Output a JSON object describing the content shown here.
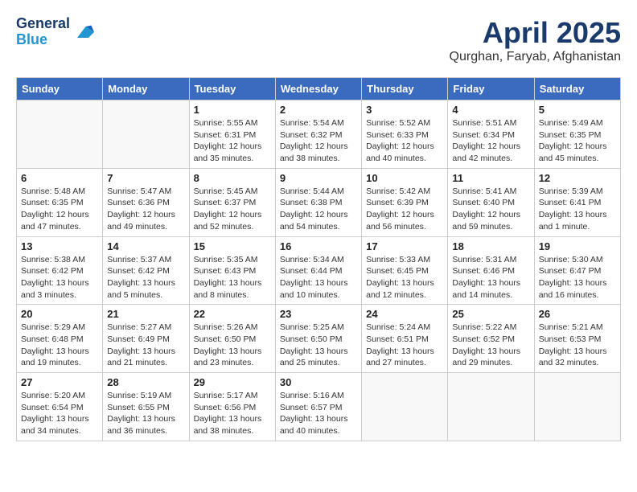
{
  "header": {
    "logo_line1": "General",
    "logo_line2": "Blue",
    "month_title": "April 2025",
    "location": "Qurghan, Faryab, Afghanistan"
  },
  "weekdays": [
    "Sunday",
    "Monday",
    "Tuesday",
    "Wednesday",
    "Thursday",
    "Friday",
    "Saturday"
  ],
  "weeks": [
    [
      {
        "day": "",
        "info": ""
      },
      {
        "day": "",
        "info": ""
      },
      {
        "day": "1",
        "info": "Sunrise: 5:55 AM\nSunset: 6:31 PM\nDaylight: 12 hours and 35 minutes."
      },
      {
        "day": "2",
        "info": "Sunrise: 5:54 AM\nSunset: 6:32 PM\nDaylight: 12 hours and 38 minutes."
      },
      {
        "day": "3",
        "info": "Sunrise: 5:52 AM\nSunset: 6:33 PM\nDaylight: 12 hours and 40 minutes."
      },
      {
        "day": "4",
        "info": "Sunrise: 5:51 AM\nSunset: 6:34 PM\nDaylight: 12 hours and 42 minutes."
      },
      {
        "day": "5",
        "info": "Sunrise: 5:49 AM\nSunset: 6:35 PM\nDaylight: 12 hours and 45 minutes."
      }
    ],
    [
      {
        "day": "6",
        "info": "Sunrise: 5:48 AM\nSunset: 6:35 PM\nDaylight: 12 hours and 47 minutes."
      },
      {
        "day": "7",
        "info": "Sunrise: 5:47 AM\nSunset: 6:36 PM\nDaylight: 12 hours and 49 minutes."
      },
      {
        "day": "8",
        "info": "Sunrise: 5:45 AM\nSunset: 6:37 PM\nDaylight: 12 hours and 52 minutes."
      },
      {
        "day": "9",
        "info": "Sunrise: 5:44 AM\nSunset: 6:38 PM\nDaylight: 12 hours and 54 minutes."
      },
      {
        "day": "10",
        "info": "Sunrise: 5:42 AM\nSunset: 6:39 PM\nDaylight: 12 hours and 56 minutes."
      },
      {
        "day": "11",
        "info": "Sunrise: 5:41 AM\nSunset: 6:40 PM\nDaylight: 12 hours and 59 minutes."
      },
      {
        "day": "12",
        "info": "Sunrise: 5:39 AM\nSunset: 6:41 PM\nDaylight: 13 hours and 1 minute."
      }
    ],
    [
      {
        "day": "13",
        "info": "Sunrise: 5:38 AM\nSunset: 6:42 PM\nDaylight: 13 hours and 3 minutes."
      },
      {
        "day": "14",
        "info": "Sunrise: 5:37 AM\nSunset: 6:42 PM\nDaylight: 13 hours and 5 minutes."
      },
      {
        "day": "15",
        "info": "Sunrise: 5:35 AM\nSunset: 6:43 PM\nDaylight: 13 hours and 8 minutes."
      },
      {
        "day": "16",
        "info": "Sunrise: 5:34 AM\nSunset: 6:44 PM\nDaylight: 13 hours and 10 minutes."
      },
      {
        "day": "17",
        "info": "Sunrise: 5:33 AM\nSunset: 6:45 PM\nDaylight: 13 hours and 12 minutes."
      },
      {
        "day": "18",
        "info": "Sunrise: 5:31 AM\nSunset: 6:46 PM\nDaylight: 13 hours and 14 minutes."
      },
      {
        "day": "19",
        "info": "Sunrise: 5:30 AM\nSunset: 6:47 PM\nDaylight: 13 hours and 16 minutes."
      }
    ],
    [
      {
        "day": "20",
        "info": "Sunrise: 5:29 AM\nSunset: 6:48 PM\nDaylight: 13 hours and 19 minutes."
      },
      {
        "day": "21",
        "info": "Sunrise: 5:27 AM\nSunset: 6:49 PM\nDaylight: 13 hours and 21 minutes."
      },
      {
        "day": "22",
        "info": "Sunrise: 5:26 AM\nSunset: 6:50 PM\nDaylight: 13 hours and 23 minutes."
      },
      {
        "day": "23",
        "info": "Sunrise: 5:25 AM\nSunset: 6:50 PM\nDaylight: 13 hours and 25 minutes."
      },
      {
        "day": "24",
        "info": "Sunrise: 5:24 AM\nSunset: 6:51 PM\nDaylight: 13 hours and 27 minutes."
      },
      {
        "day": "25",
        "info": "Sunrise: 5:22 AM\nSunset: 6:52 PM\nDaylight: 13 hours and 29 minutes."
      },
      {
        "day": "26",
        "info": "Sunrise: 5:21 AM\nSunset: 6:53 PM\nDaylight: 13 hours and 32 minutes."
      }
    ],
    [
      {
        "day": "27",
        "info": "Sunrise: 5:20 AM\nSunset: 6:54 PM\nDaylight: 13 hours and 34 minutes."
      },
      {
        "day": "28",
        "info": "Sunrise: 5:19 AM\nSunset: 6:55 PM\nDaylight: 13 hours and 36 minutes."
      },
      {
        "day": "29",
        "info": "Sunrise: 5:17 AM\nSunset: 6:56 PM\nDaylight: 13 hours and 38 minutes."
      },
      {
        "day": "30",
        "info": "Sunrise: 5:16 AM\nSunset: 6:57 PM\nDaylight: 13 hours and 40 minutes."
      },
      {
        "day": "",
        "info": ""
      },
      {
        "day": "",
        "info": ""
      },
      {
        "day": "",
        "info": ""
      }
    ]
  ]
}
